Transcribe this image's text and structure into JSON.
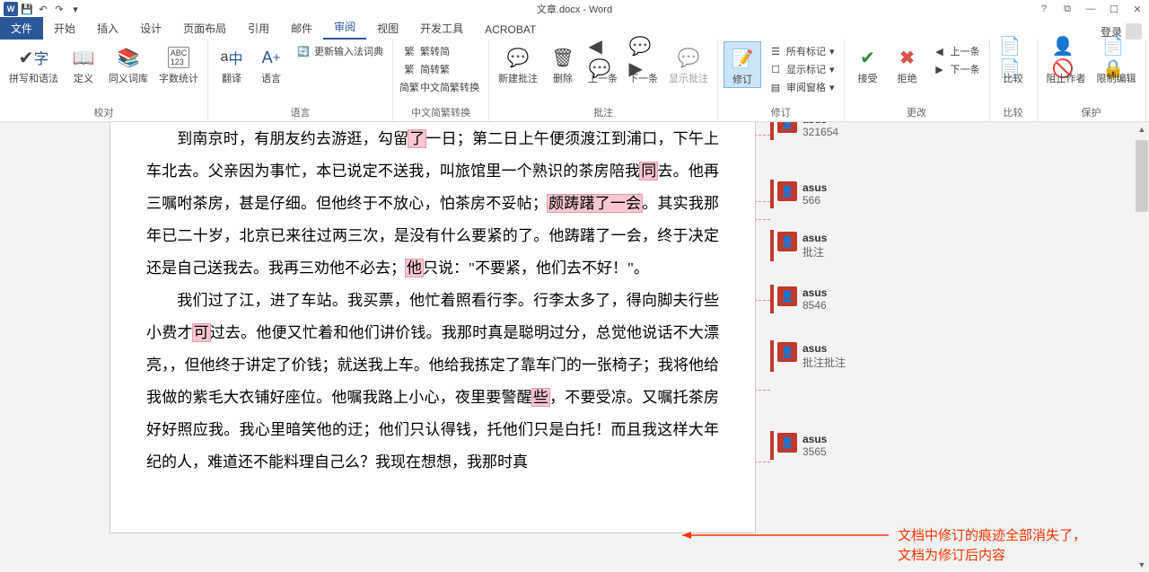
{
  "titlebar": {
    "title": "文章.docx - Word",
    "help_icon": "?",
    "restore_icon": "⧉",
    "min_icon": "—",
    "max_icon": "☐",
    "close_icon": "✕"
  },
  "tabs": {
    "file": "文件",
    "items": [
      "开始",
      "插入",
      "设计",
      "页面布局",
      "引用",
      "邮件",
      "审阅",
      "视图",
      "开发工具",
      "ACROBAT"
    ],
    "active_index": 6,
    "signin": "登录"
  },
  "ribbon": {
    "proofing": {
      "spelling": "拼写和语法",
      "define": "定义",
      "thesaurus": "同义词库",
      "wordcount": "字数统计",
      "label": "校对",
      "abc": "ABC",
      "num": "123"
    },
    "language": {
      "translate": "翻译",
      "language": "语言",
      "update_ime": "更新输入法词典",
      "label": "语言"
    },
    "chinese": {
      "sc_tc": "繁转简",
      "tc_sc": "简转繁",
      "convert": "中文简繁转换",
      "label": "中文简繁转换",
      "char1": "简",
      "char2": "繁"
    },
    "comments": {
      "new": "新建批注",
      "delete": "删除",
      "prev": "上一条",
      "next": "下一条",
      "show": "显示批注",
      "label": "批注"
    },
    "tracking": {
      "track": "修订",
      "all_markup": "所有标记",
      "show_markup": "显示标记",
      "reviewing_pane": "审阅窗格",
      "label": "修订"
    },
    "changes": {
      "accept": "接受",
      "reject": "拒绝",
      "prev": "上一条",
      "next": "下一条",
      "label": "更改"
    },
    "compare": {
      "compare": "比较",
      "label": "比较"
    },
    "protect": {
      "block": "阻止作者",
      "restrict": "限制编辑",
      "label": "保护"
    }
  },
  "document": {
    "paragraphs": [
      "到南京时，有朋友约去游逛，勾留|了|一日；第二日上午便须渡江到浦口，下午上车北去。父亲因为事忙，本已说定不送我，叫旅馆里一个熟识的茶房陪我|同|去。他再三嘱咐茶房，甚是仔细。但他终于不放心，怕茶房不妥帖；|颇踌躇了一会|。其实我那年已二十岁，北京已来往过两三次，是没有什么要紧的了。他踌躇了一会，终于决定还是自己送我去。我再三劝他不必去；|他|只说：\"不要紧，他们去不好！\"。",
      "我们过了江，进了车站。我买票，他忙着照看行李。行李太多了，得向脚夫行些小费才|可|过去。他便又忙着和他们讲价钱。我那时真是聪明过分，总觉他说话不大漂亮，，但他终于讲定了价钱；就送我上车。他给我拣定了靠车门的一张椅子；我将他给我做的紫毛大衣铺好座位。他嘱我路上小心，夜里要警醒|些|，不要受凉。又嘱托茶房好好照应我。我心里暗笑他的迂；他们只认得钱，托他们只是白托！而且我这样大年纪的人，难道还不能料理自己么？我现在想想，我那时真"
    ]
  },
  "comment_list": [
    {
      "author": "asus",
      "body": "321654"
    },
    {
      "author": "asus",
      "body": "566"
    },
    {
      "author": "asus",
      "body": "批注"
    },
    {
      "author": "asus",
      "body": "8546"
    },
    {
      "author": "asus",
      "body": "批注批注"
    },
    {
      "author": "asus",
      "body": "3565"
    }
  ],
  "annotation": {
    "line1": "文档中修订的痕迹全部消失了，",
    "line2": "文档为修订后内容"
  }
}
